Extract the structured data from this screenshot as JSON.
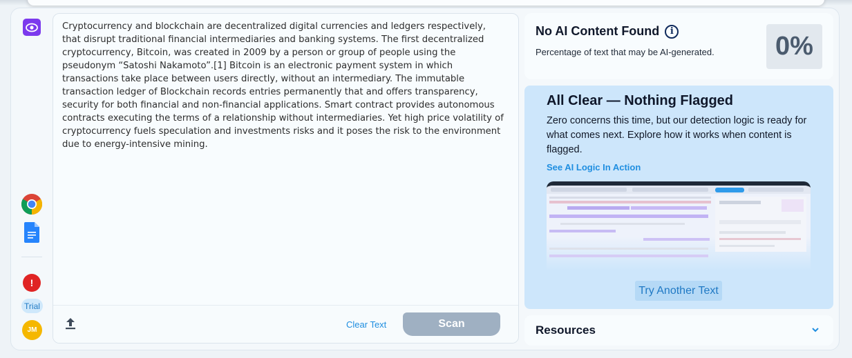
{
  "rail": {
    "trial_label": "Trial",
    "avatar_initials": "JM",
    "alert_symbol": "!"
  },
  "editor": {
    "text": "Cryptocurrency and blockchain are decentralized digital currencies and ledgers respectively, that disrupt traditional financial intermediaries and banking systems. The first decentralized cryptocurrency, Bitcoin, was created in 2009 by a person or group of people using the pseudonym “Satoshi Nakamoto”.[1] Bitcoin is an electronic payment system in which transactions take place between users directly, without an intermediary. The immutable transaction ledger of Blockchain records entries permanently that and offers transparency, security for both financial and non-financial applications. Smart contract provides autonomous contracts executing the terms of a relationship without intermediaries. Yet high price volatility of cryptocurrency fuels speculation and investments risks and it poses the risk to the environment due to energy-intensive mining.",
    "clear_label": "Clear Text",
    "scan_label": "Scan"
  },
  "result": {
    "title": "No AI Content Found",
    "subtitle": "Percentage of text that may be AI-generated.",
    "percent": "0%"
  },
  "panel": {
    "title": "All Clear — Nothing Flagged",
    "body": "Zero concerns this time, but our detection logic is ready for what comes next. Explore how it works when content is flagged.",
    "link": "See AI Logic In Action",
    "button": "Try Another Text"
  },
  "resources": {
    "label": "Resources"
  },
  "colors": {
    "accent": "#1f8ee0",
    "brand": "#7c3aed",
    "panel_bg": "#cde6fb",
    "scan_disabled": "#9fb0c2"
  }
}
